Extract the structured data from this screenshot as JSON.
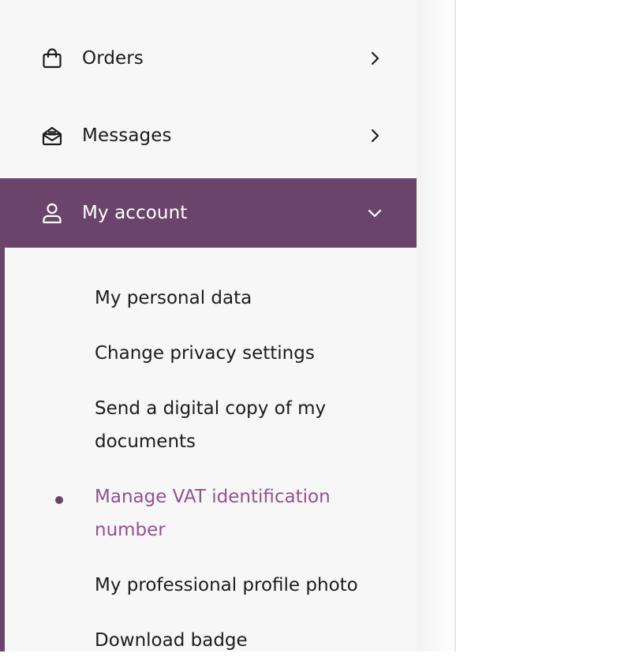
{
  "sidebar": {
    "items": [
      {
        "label": "Orders",
        "icon": "shopping-bag-icon",
        "state": "collapsed"
      },
      {
        "label": "Messages",
        "icon": "envelope-icon",
        "state": "collapsed"
      },
      {
        "label": "My account",
        "icon": "user-icon",
        "state": "expanded"
      }
    ],
    "account_submenu": [
      {
        "label": "My personal data"
      },
      {
        "label": "Change privacy settings"
      },
      {
        "label": "Send a digital copy of my documents"
      },
      {
        "label": "Manage VAT identification number",
        "active": true
      },
      {
        "label": "My professional profile photo"
      },
      {
        "label": "Download badge"
      }
    ]
  },
  "colors": {
    "accent": "#6b446c",
    "active_link": "#94518f",
    "sidebar_bg": "#f7f7f7",
    "text": "#1c1c1c"
  }
}
